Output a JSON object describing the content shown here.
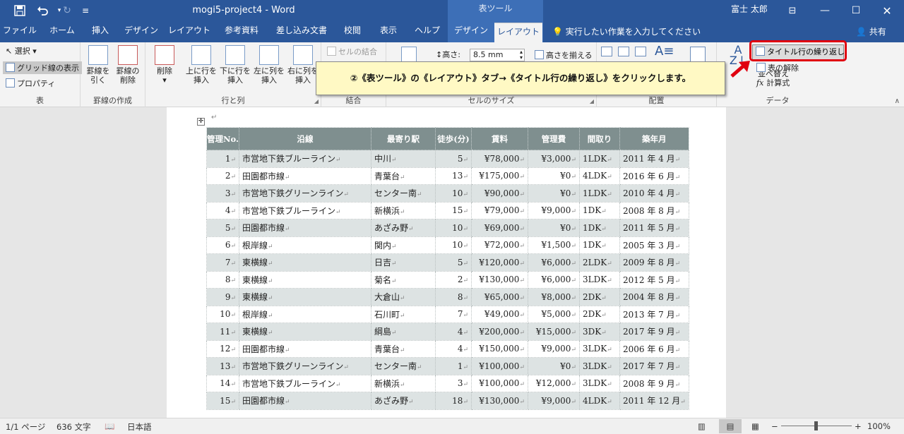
{
  "titlebar": {
    "doc_title": "mogi5-project4  -  Word",
    "context_group": "表ツール",
    "user_name": "富士 太郎"
  },
  "tabs": [
    {
      "label": "ファイル"
    },
    {
      "label": "ホーム"
    },
    {
      "label": "挿入"
    },
    {
      "label": "デザイン"
    },
    {
      "label": "レイアウト"
    },
    {
      "label": "参考資料"
    },
    {
      "label": "差し込み文書"
    },
    {
      "label": "校閲"
    },
    {
      "label": "表示"
    },
    {
      "label": "ヘルプ"
    },
    {
      "label": "デザイン"
    },
    {
      "label": "レイアウト"
    }
  ],
  "tell_me": "実行したい作業を入力してください",
  "share": "共有",
  "ribbon": {
    "table": {
      "select": "選択",
      "gridlines": "グリッド線の表示",
      "properties": "プロパティ",
      "label": "表"
    },
    "draw": {
      "draw_table": "罫線を引く",
      "eraser": "罫線の削除",
      "label": "罫線の作成"
    },
    "rowscols": {
      "delete": "削除",
      "insert_above": "上に行を挿入",
      "insert_below": "下に行を挿入",
      "insert_left": "左に列を挿入",
      "insert_right": "右に列を挿入",
      "label": "行と列"
    },
    "merge": {
      "merge_cells": "セルの結合",
      "label": "結合"
    },
    "cellsize": {
      "height_label": "高さ:",
      "height_value": "8.5 mm",
      "distribute_rows": "高さを揃える",
      "label": "セルのサイズ"
    },
    "alignment": {
      "label": "配置"
    },
    "data": {
      "sort": "並べ替え",
      "repeat_header": "タイトル行の繰り返し",
      "convert": "表の解除",
      "formula": "計算式",
      "label": "データ"
    }
  },
  "callout": "②《表ツール》の《レイアウト》タブ→《タイトル行の繰り返し》をクリックします。",
  "table": {
    "headers": [
      "管理No.",
      "沿線",
      "最寄り駅",
      "徒歩(分)",
      "賃料",
      "管理費",
      "間取り",
      "築年月"
    ],
    "rows": [
      [
        "1",
        "市営地下鉄ブルーライン",
        "中川",
        "5",
        "¥78,000",
        "¥3,000",
        "1LDK",
        "2011 年 4 月"
      ],
      [
        "2",
        "田園都市線",
        "青葉台",
        "13",
        "¥175,000",
        "¥0",
        "4LDK",
        "2016 年 6 月"
      ],
      [
        "3",
        "市営地下鉄グリーンライン",
        "センター南",
        "10",
        "¥90,000",
        "¥0",
        "1LDK",
        "2010 年 4 月"
      ],
      [
        "4",
        "市営地下鉄ブルーライン",
        "新横浜",
        "15",
        "¥79,000",
        "¥9,000",
        "1DK",
        "2008 年 8 月"
      ],
      [
        "5",
        "田園都市線",
        "あざみ野",
        "10",
        "¥69,000",
        "¥0",
        "1DK",
        "2011 年 5 月"
      ],
      [
        "6",
        "根岸線",
        "関内",
        "10",
        "¥72,000",
        "¥1,500",
        "1DK",
        "2005 年 3 月"
      ],
      [
        "7",
        "東横線",
        "日吉",
        "5",
        "¥120,000",
        "¥6,000",
        "2LDK",
        "2009 年 8 月"
      ],
      [
        "8",
        "東横線",
        "菊名",
        "2",
        "¥130,000",
        "¥6,000",
        "3LDK",
        "2012 年 5 月"
      ],
      [
        "9",
        "東横線",
        "大倉山",
        "8",
        "¥65,000",
        "¥8,000",
        "2DK",
        "2004 年 8 月"
      ],
      [
        "10",
        "根岸線",
        "石川町",
        "7",
        "¥49,000",
        "¥5,000",
        "2DK",
        "2013 年 7 月"
      ],
      [
        "11",
        "東横線",
        "綱島",
        "4",
        "¥200,000",
        "¥15,000",
        "3DK",
        "2017 年 9 月"
      ],
      [
        "12",
        "田園都市線",
        "青葉台",
        "4",
        "¥150,000",
        "¥9,000",
        "3LDK",
        "2006 年 6 月"
      ],
      [
        "13",
        "市営地下鉄グリーンライン",
        "センター南",
        "1",
        "¥100,000",
        "¥0",
        "3LDK",
        "2017 年 7 月"
      ],
      [
        "14",
        "市営地下鉄ブルーライン",
        "新横浜",
        "3",
        "¥100,000",
        "¥12,000",
        "3LDK",
        "2008 年 9 月"
      ],
      [
        "15",
        "田園都市線",
        "あざみ野",
        "18",
        "¥130,000",
        "¥9,000",
        "4LDK",
        "2011 年 12 月"
      ]
    ]
  },
  "status": {
    "pages": "1/1 ページ",
    "words": "636 文字",
    "language": "日本語",
    "zoom": "100%"
  }
}
